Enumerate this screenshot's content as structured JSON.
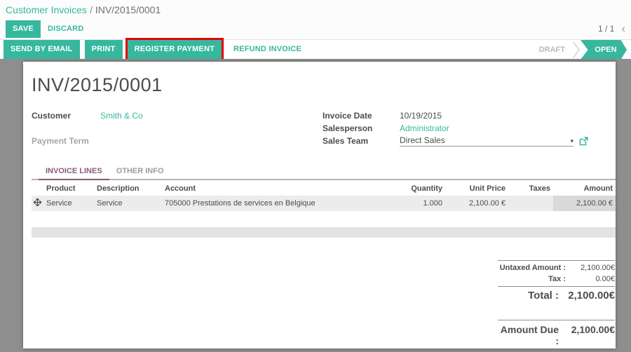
{
  "colors": {
    "accent": "#36b79e",
    "tab_active": "#875a7b",
    "highlight_border": "#e60000",
    "page_background": "#8e8e8e"
  },
  "breadcrumb": {
    "parent": "Customer Invoices",
    "separator": "/",
    "current": "INV/2015/0001"
  },
  "header_actions": {
    "save": "SAVE",
    "discard": "DISCARD"
  },
  "pager": {
    "value": "1 / 1",
    "prev_icon": "‹"
  },
  "toolbar": {
    "send_by_email": "SEND BY EMAIL",
    "print": "PRINT",
    "register_payment": "REGISTER PAYMENT",
    "refund_invoice": "REFUND INVOICE"
  },
  "statusbar": {
    "draft": "DRAFT",
    "open": "OPEN"
  },
  "invoice": {
    "title": "INV/2015/0001",
    "customer_label": "Customer",
    "customer": "Smith & Co",
    "payment_term_label": "Payment Term",
    "invoice_date_label": "Invoice Date",
    "invoice_date": "10/19/2015",
    "salesperson_label": "Salesperson",
    "salesperson": "Administrator",
    "sales_team_label": "Sales Team",
    "sales_team": "Direct Sales",
    "caret_icon": "▾"
  },
  "notebook": {
    "tab_invoice_lines": "INVOICE LINES",
    "tab_other_info": "OTHER INFO"
  },
  "lines_table": {
    "headers": [
      "Product",
      "Description",
      "Account",
      "Quantity",
      "Unit Price",
      "Taxes",
      "Amount"
    ],
    "rows": [
      {
        "product": "Service",
        "description": "Service",
        "account": "705000 Prestations de services en Belgique",
        "quantity": "1.000",
        "unit_price": "2,100.00 €",
        "taxes": "",
        "amount": "2,100.00 €"
      }
    ]
  },
  "totals": {
    "untaxed_label": "Untaxed Amount :",
    "untaxed": "2,100.00€",
    "tax_label": "Tax :",
    "tax": "0.00€",
    "total_label": "Total :",
    "total": "2,100.00€",
    "amount_due_label": "Amount Due :",
    "amount_due": "2,100.00€"
  }
}
